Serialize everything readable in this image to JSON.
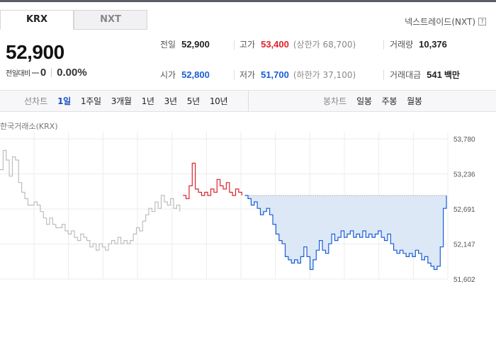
{
  "tabs": {
    "krx": "KRX",
    "nxt": "NXT"
  },
  "nxt_link": {
    "label": "넥스트레이드(NXT)",
    "icon": "help-icon",
    "icon_glyph": "?"
  },
  "price": {
    "current": "52,900",
    "change_label": "전일대비",
    "change_value": "0",
    "change_percent": "0.00%"
  },
  "stats": {
    "prev_close": {
      "label": "전일",
      "value": "52,900"
    },
    "high": {
      "label": "고가",
      "value": "53,400",
      "limit": "(상한가 68,700)"
    },
    "volume": {
      "label": "거래량",
      "value": "10,376"
    },
    "open": {
      "label": "시가",
      "value": "52,800"
    },
    "low": {
      "label": "저가",
      "value": "51,700",
      "limit": "(하한가 37,100)"
    },
    "amount": {
      "label": "거래대금",
      "value": "541",
      "unit": "백만"
    }
  },
  "period": {
    "line_label": "선차트",
    "line_options": [
      "1일",
      "1주일",
      "3개월",
      "1년",
      "3년",
      "5년",
      "10년"
    ],
    "line_selected": "1일",
    "candle_label": "봉차트",
    "candle_options": [
      "일봉",
      "주봉",
      "월봉"
    ]
  },
  "exchange_label": "한국거래소(KRX)",
  "colors": {
    "up": "#e0222a",
    "down": "#1a5dd6",
    "prior": "#bdbdbd",
    "fill": "#dde8f7"
  },
  "chart_data": {
    "type": "line",
    "title": "",
    "xlabel": "",
    "ylabel": "",
    "yticks": [
      "53,780",
      "53,236",
      "52,691",
      "52,147",
      "51,602"
    ],
    "ylim": [
      51602,
      53780
    ],
    "reference": 52900,
    "grid": true,
    "series": [
      {
        "values": [
          53300,
          53600,
          53450,
          53200,
          53500,
          53450,
          53100,
          52950,
          52850,
          52750,
          52750,
          52800,
          52750,
          52650,
          52550,
          52450,
          52550,
          52450,
          52400,
          52400,
          52450,
          52350,
          52300,
          52350,
          52250,
          52200,
          52300,
          52250,
          52200,
          52100,
          52150,
          52050,
          52150,
          52100,
          52050,
          52150,
          52200,
          52150,
          52250,
          52150,
          52200,
          52150,
          52200,
          52300,
          52400,
          52350,
          52500,
          52600,
          52700,
          52650,
          52800,
          52700,
          52900,
          52800,
          52750,
          52850,
          52700,
          52750,
          52650
        ]
      },
      {
        "values": [
          52900,
          52850,
          53050,
          53400,
          53000,
          52950,
          52900,
          52950,
          52900,
          53000,
          52950,
          53150,
          53050,
          53000,
          53100,
          52950,
          52900,
          53000,
          52950,
          52900
        ]
      },
      {
        "values": [
          52900,
          52850,
          52750,
          52800,
          52700,
          52600,
          52650,
          52700,
          52600,
          52450,
          52300,
          52200,
          52150,
          51950,
          51900,
          51850,
          51900,
          51850,
          51950,
          52100,
          51950,
          51750,
          51900,
          52050,
          52200,
          52050,
          52000,
          52150,
          52300,
          52200,
          52250,
          52350,
          52250,
          52300,
          52350,
          52250,
          52300,
          52250,
          52350,
          52250,
          52300,
          52250,
          52300,
          52350,
          52250,
          52200,
          52300,
          52150,
          52050,
          52000,
          52050,
          52000,
          51950,
          52000,
          51950,
          52050,
          52000,
          51900,
          51950,
          51850,
          51800,
          51750,
          51800,
          52100,
          52700,
          52900
        ]
      }
    ]
  }
}
